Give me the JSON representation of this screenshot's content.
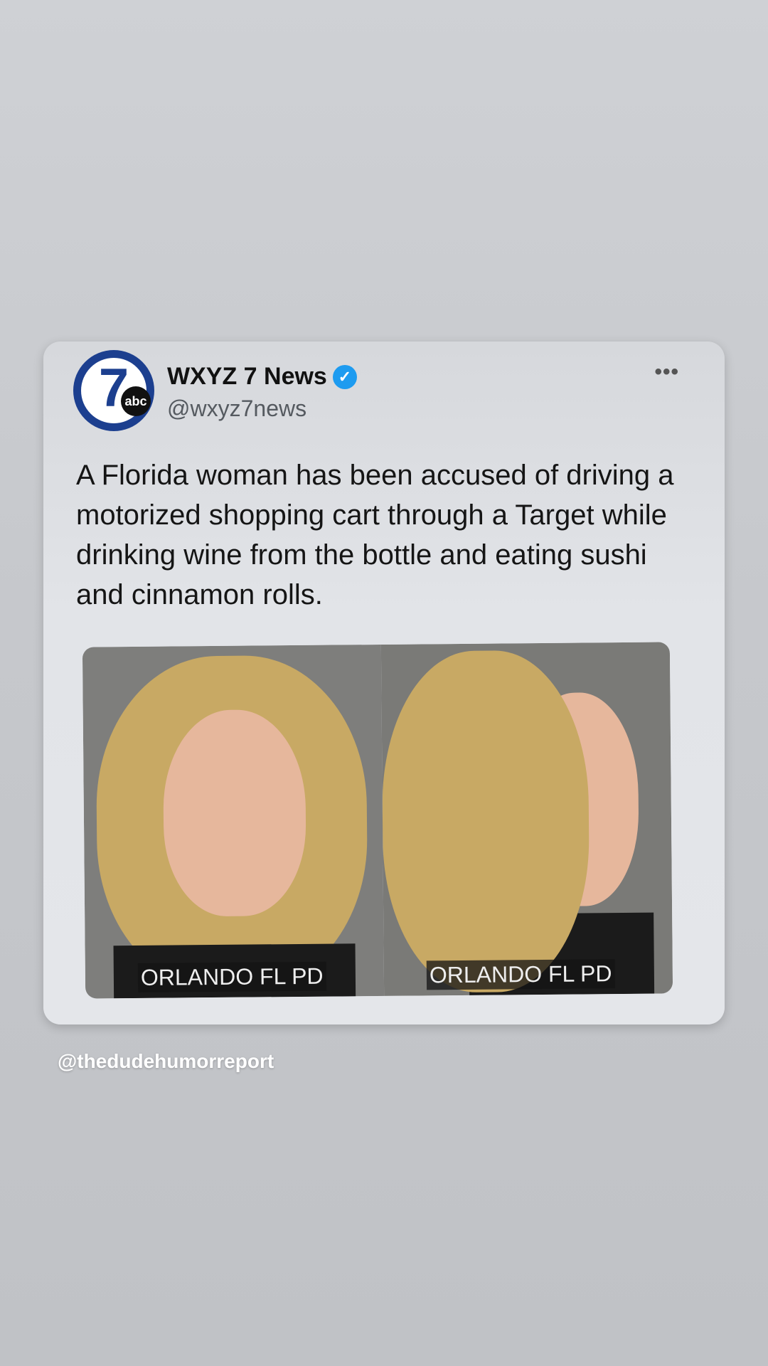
{
  "tweet": {
    "account_name": "WXYZ 7 News",
    "handle": "@wxyz7news",
    "avatar_label": "7",
    "avatar_badge": "abc",
    "text": "A Florida woman has been accused of driving a motorized shopping cart through a Target while drinking wine from the bottle and eating sushi and cinnamon rolls.",
    "more_label": "•••",
    "media": {
      "left_caption": "ORLANDO FL PD",
      "right_caption": "ORLANDO FL PD"
    }
  },
  "watermark": "@thedudehumorreport",
  "icons": {
    "verified": "verified-badge-icon",
    "more": "more-options-icon"
  },
  "colors": {
    "verified": "#1d9bf0",
    "avatar": "#1c3f8f"
  }
}
